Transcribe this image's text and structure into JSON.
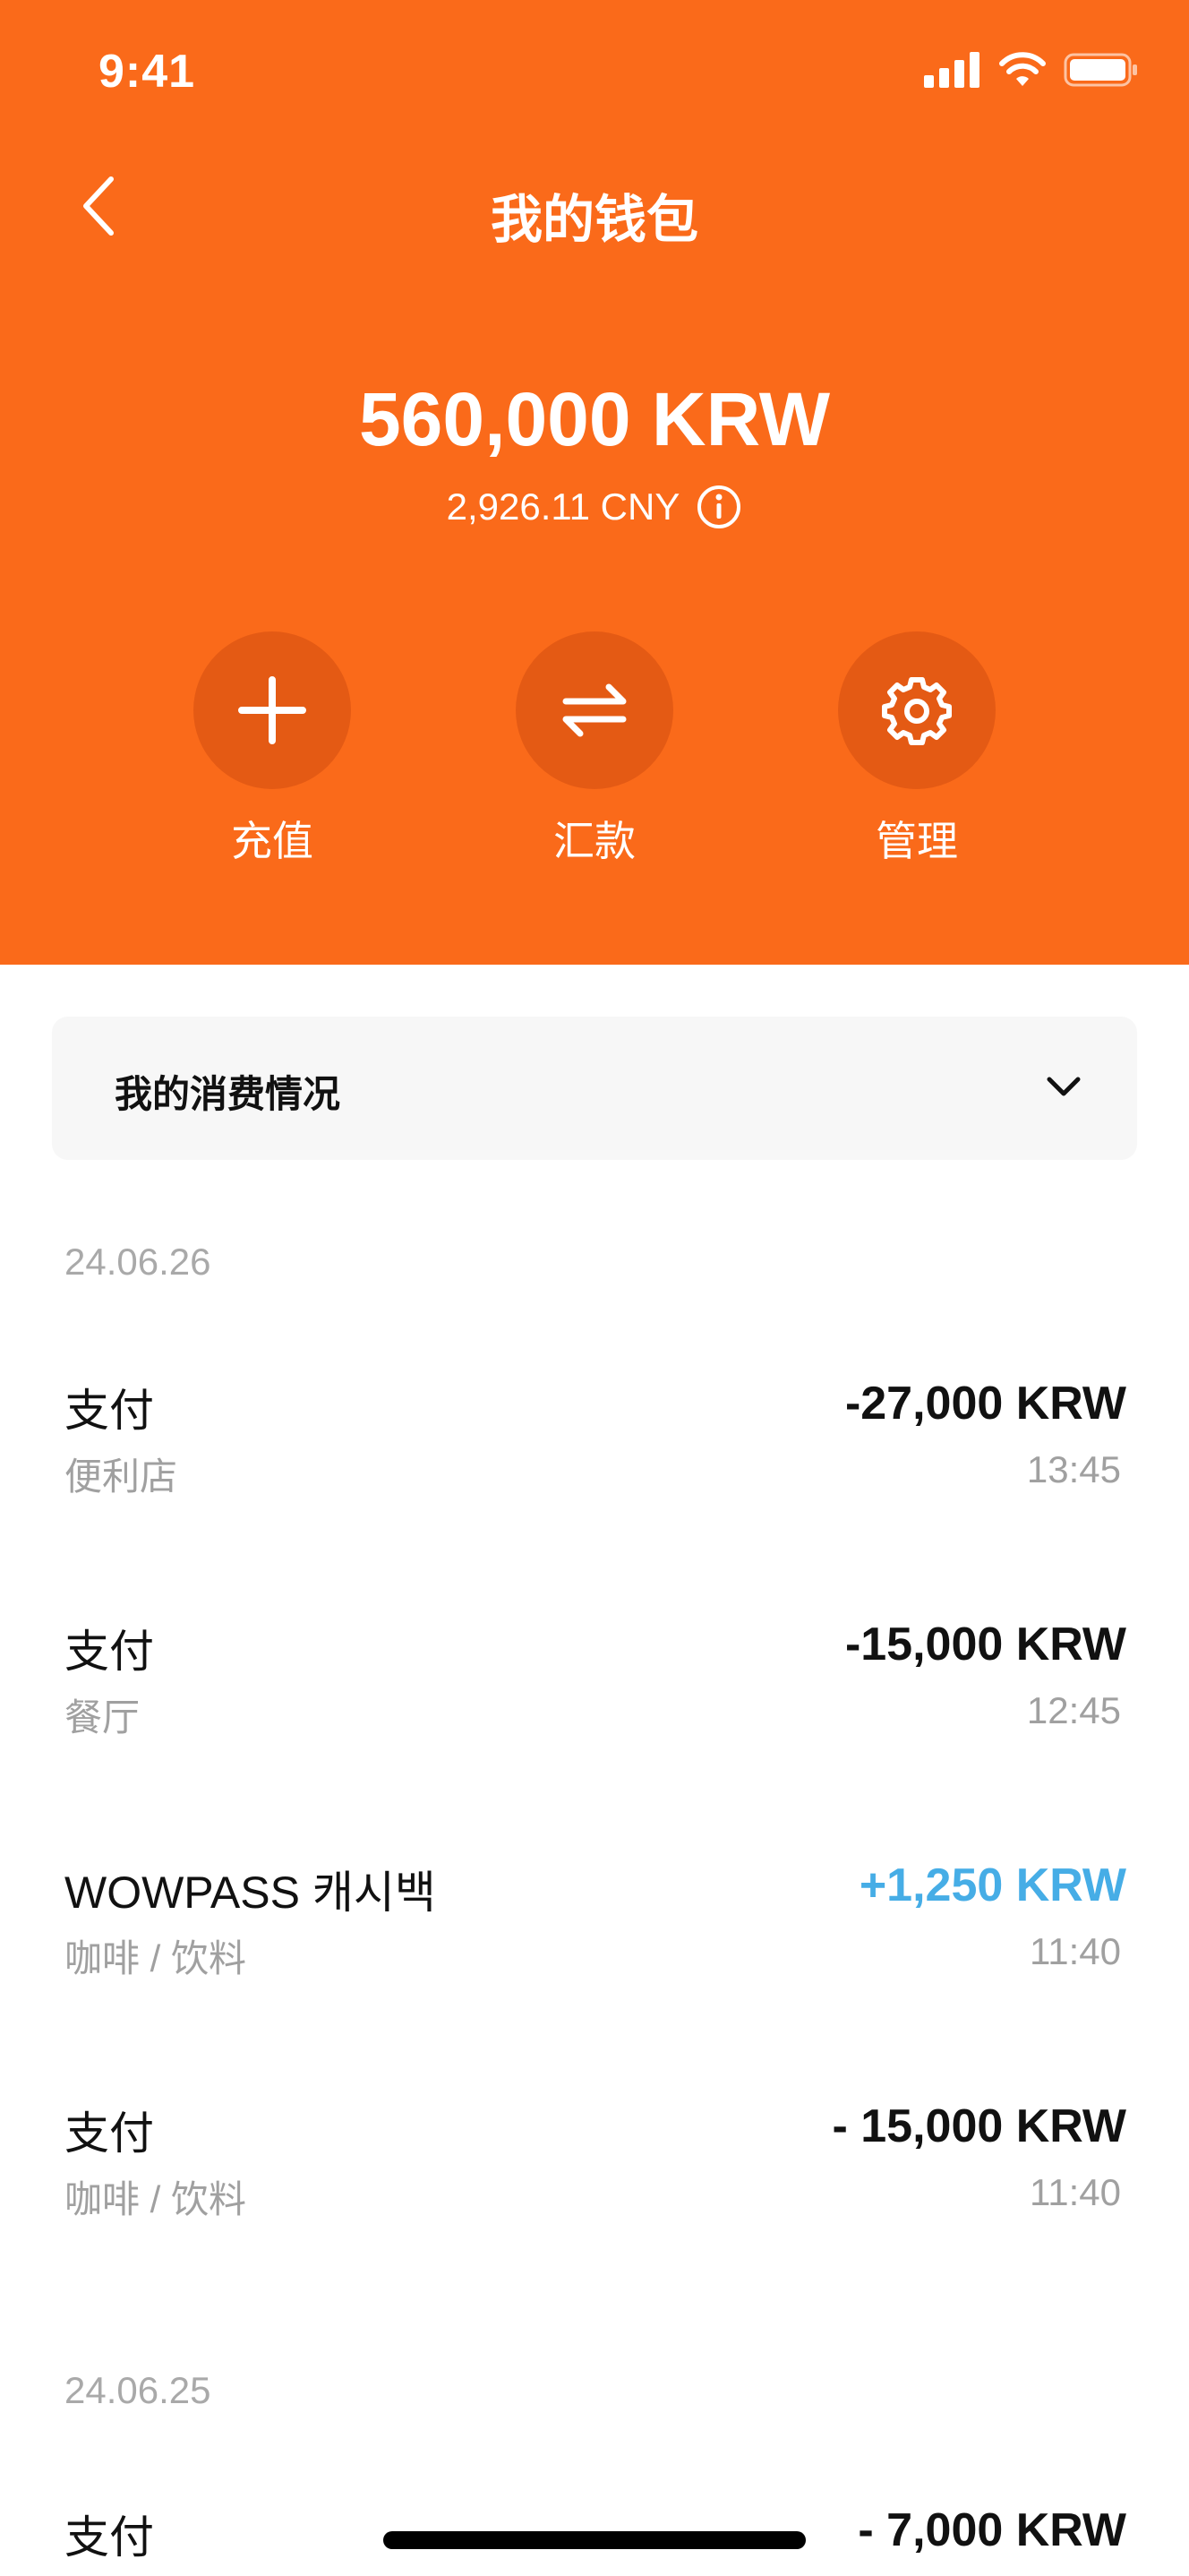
{
  "status_bar": {
    "time": "9:41",
    "icons": [
      "signal-icon",
      "wifi-icon",
      "battery-icon"
    ]
  },
  "nav": {
    "title": "我的钱包",
    "back_icon": "chevron-left-icon"
  },
  "wallet": {
    "balance": "560,000 KRW",
    "converted": "2,926.11 CNY",
    "info_icon": "info-icon"
  },
  "actions": [
    {
      "label": "充值",
      "icon": "plus-icon"
    },
    {
      "label": "汇款",
      "icon": "transfer-icon"
    },
    {
      "label": "管理",
      "icon": "gear-icon"
    }
  ],
  "summary": {
    "title": "我的消费情况",
    "icon": "chevron-down-icon"
  },
  "dates": [
    "24.06.26",
    "24.06.25"
  ],
  "transactions": [
    {
      "title": "支付",
      "category": "便利店",
      "amount": "-27,000 KRW",
      "time": "13:45"
    },
    {
      "title": "支付",
      "category": "餐厅",
      "amount": "-15,000 KRW",
      "time": "12:45"
    },
    {
      "title": "WOWPASS 캐시백",
      "category": "咖啡 / 饮料",
      "amount": "+1,250 KRW",
      "time": "11:40"
    },
    {
      "title": "支付",
      "category": "咖啡 / 饮料",
      "amount": "- 15,000 KRW",
      "time": "11:40"
    },
    {
      "title": "支付",
      "category": "",
      "amount": "- 7,000 KRW",
      "time": ""
    }
  ],
  "colors": {
    "brand": "#FA6A1A",
    "action_circle": "#E45A14",
    "positive_amount": "#46ADE6",
    "muted_text": "#A0A0A0"
  }
}
